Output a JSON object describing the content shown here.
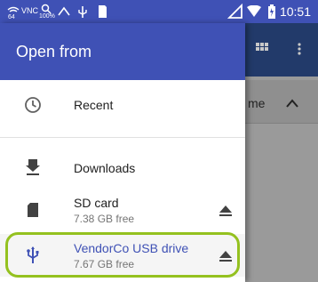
{
  "status_bar": {
    "vnc": "VNC",
    "percent": "100%",
    "cell_label": "64",
    "clock": "10:51"
  },
  "background": {
    "header_label": "me"
  },
  "drawer": {
    "title": "Open from",
    "items": [
      {
        "label": "Recent",
        "icon": "clock-icon"
      },
      {
        "label": "Downloads",
        "icon": "download-icon"
      },
      {
        "label": "SD card",
        "sub": "7.38 GB free",
        "icon": "sd-card-icon"
      },
      {
        "label": "VendorCo USB drive",
        "sub": "7.67 GB free",
        "icon": "usb-icon",
        "highlighted": true
      }
    ]
  },
  "colors": {
    "primary": "#3f51b5",
    "highlight": "#94c11f"
  }
}
